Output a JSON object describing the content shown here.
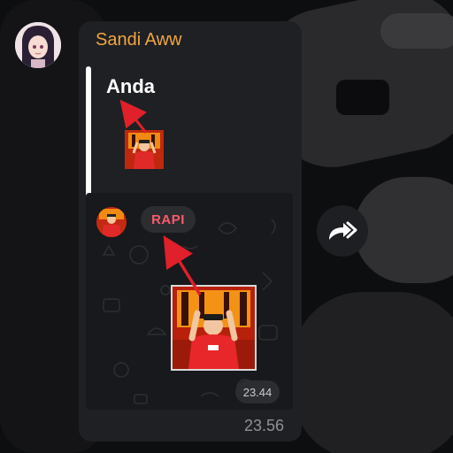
{
  "message": {
    "sender_name": "Sandi Aww",
    "reply_to": {
      "name": "Anda"
    },
    "forwarded_tag": {
      "label": "RAPI"
    },
    "inner_time": "23.44",
    "outer_time": "23.56"
  },
  "icons": {
    "avatar": "anime-girl-avatar",
    "forward": "forward-arrow-icon",
    "reply_thumb": "sticker-thumbnail",
    "sticker": "man-sticker"
  },
  "colors": {
    "sender_name": "#f0a640",
    "tag_text": "#ff5a6a",
    "annotation_arrow": "#e0202a",
    "bubble": "#1e2023"
  }
}
